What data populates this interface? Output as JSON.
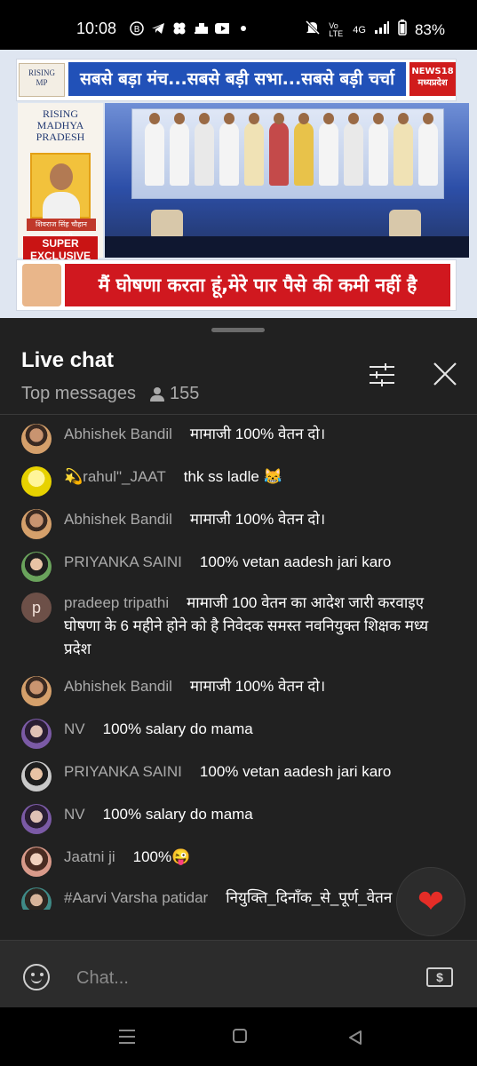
{
  "status_bar": {
    "time": "10:08",
    "network": "Vo LTE",
    "signal": "4G",
    "battery": "83%",
    "icons_left": [
      "b-icon",
      "telegram-icon",
      "pinwheel-icon",
      "app-icon",
      "youtube-icon",
      "dot-icon"
    ]
  },
  "video": {
    "top_headline": "सबसे बड़ा मंच...सबसे बड़ी सभा...सबसे बड़ी चर्चा",
    "logo_text": "RISING MADHYA PRADESH",
    "channel": "NEWS18 मध्यप्रदेश",
    "name_tag": "शिवराज सिंह चौहान मुख्यमंत्री",
    "badge_line1": "SUPER",
    "badge_line2": "EXCLUSIVE",
    "bottom_headline": "मैं घोषणा करता हूं,मेरे पार पैसे की कमी नहीं है"
  },
  "chat": {
    "title": "Live chat",
    "mode": "Top messages",
    "viewers": "155",
    "input_placeholder": "Chat...",
    "messages": [
      {
        "author": "Abhishek Bandil",
        "text": "मामाजी 100% वेतन दो।"
      },
      {
        "author": "💫rahul\"_JAAT",
        "text": "thk ss ladle 😹"
      },
      {
        "author": "Abhishek Bandil",
        "text": "मामाजी 100% वेतन दो।"
      },
      {
        "author": "PRIYANKA SAINI",
        "text": "100% vetan aadesh jari karo"
      },
      {
        "author": "pradeep tripathi",
        "text": "मामाजी 100 वेतन का आदेश जारी करवाइए घोषणा के 6 महीने होने को है निवेदक समस्त नवनियुक्त शिक्षक मध्य प्रदेश",
        "avatar_letter": "p"
      },
      {
        "author": "Abhishek Bandil",
        "text": "मामाजी 100% वेतन दो।"
      },
      {
        "author": "NV",
        "text": "100% salary do mama"
      },
      {
        "author": "PRIYANKA SAINI",
        "text": "100% vetan aadesh jari karo"
      },
      {
        "author": "NV",
        "text": "100% salary do mama"
      },
      {
        "author": "Jaatni ji",
        "text": "100%😜"
      },
      {
        "author": "#Aarvi Varsha patidar",
        "text": "नियुक्ति_दिनाँक_से_पूर्ण_वेतन मामाजी"
      }
    ]
  },
  "colors": {
    "panel_bg": "#212121",
    "author_gray": "#aaaaaa",
    "heart_red": "#e52d27",
    "headline_blue": "#2151b8",
    "headline_red": "#d0181f"
  }
}
